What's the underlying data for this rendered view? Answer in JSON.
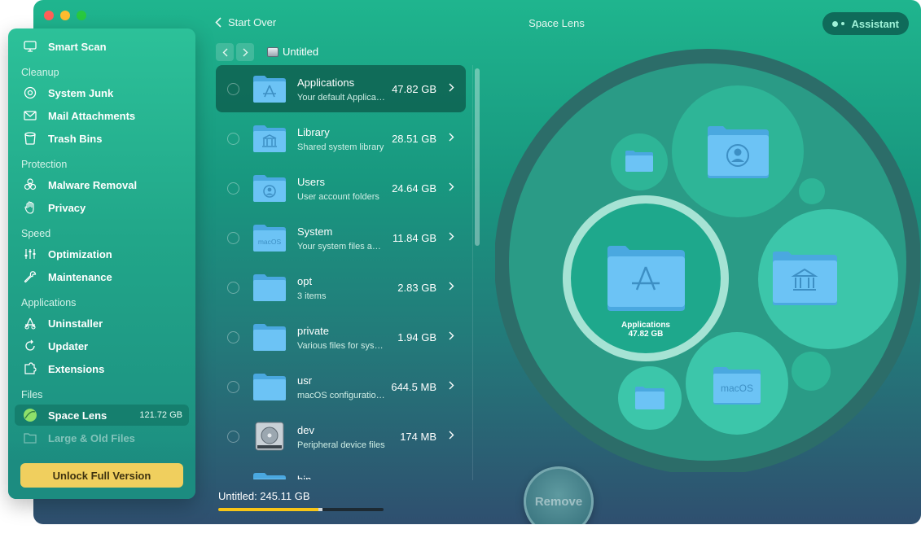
{
  "window": {
    "title": "Space Lens",
    "back_label": "Start Over",
    "assistant_label": "Assistant"
  },
  "sidebar": {
    "smart_scan": "Smart Scan",
    "sections": {
      "cleanup": "Cleanup",
      "protection": "Protection",
      "speed": "Speed",
      "applications": "Applications",
      "files": "Files"
    },
    "items": {
      "system_junk": "System Junk",
      "mail_attachments": "Mail Attachments",
      "trash_bins": "Trash Bins",
      "malware_removal": "Malware Removal",
      "privacy": "Privacy",
      "optimization": "Optimization",
      "maintenance": "Maintenance",
      "uninstaller": "Uninstaller",
      "updater": "Updater",
      "extensions": "Extensions",
      "space_lens": "Space Lens",
      "space_lens_size": "121.72 GB",
      "large_old_files": "Large & Old Files"
    },
    "unlock_label": "Unlock Full Version"
  },
  "breadcrumb": {
    "current": "Untitled"
  },
  "files": [
    {
      "name": "Applications",
      "desc": "Your default Applications folder",
      "size": "47.82 GB",
      "icon": "app-store-folder-icon",
      "selected": true
    },
    {
      "name": "Library",
      "desc": "Shared system library",
      "size": "28.51 GB",
      "icon": "library-folder-icon"
    },
    {
      "name": "Users",
      "desc": "User account folders",
      "size": "24.64 GB",
      "icon": "user-folder-icon"
    },
    {
      "name": "System",
      "desc": "Your system files and folders",
      "size": "11.84 GB",
      "icon": "macos-folder-icon"
    },
    {
      "name": "opt",
      "desc": "3 items",
      "size": "2.83 GB",
      "icon": "folder-icon"
    },
    {
      "name": "private",
      "desc": "Various files for system",
      "size": "1.94 GB",
      "icon": "folder-icon"
    },
    {
      "name": "usr",
      "desc": "macOS configuration files",
      "size": "644.5 MB",
      "icon": "folder-icon"
    },
    {
      "name": "dev",
      "desc": "Peripheral device files",
      "size": "174 MB",
      "icon": "hard-disk-icon"
    },
    {
      "name": "bin",
      "desc": "",
      "size": "",
      "icon": "folder-icon"
    }
  ],
  "disk": {
    "label": "Untitled: 245.11 GB",
    "used_fraction": 0.63
  },
  "bubble": {
    "name": "Applications",
    "size": "47.82 GB"
  },
  "remove_label": "Remove",
  "colors": {
    "accent_yellow": "#f0cf5e",
    "folder_blue": "#5cb8f0",
    "selection": "#0c584a"
  }
}
